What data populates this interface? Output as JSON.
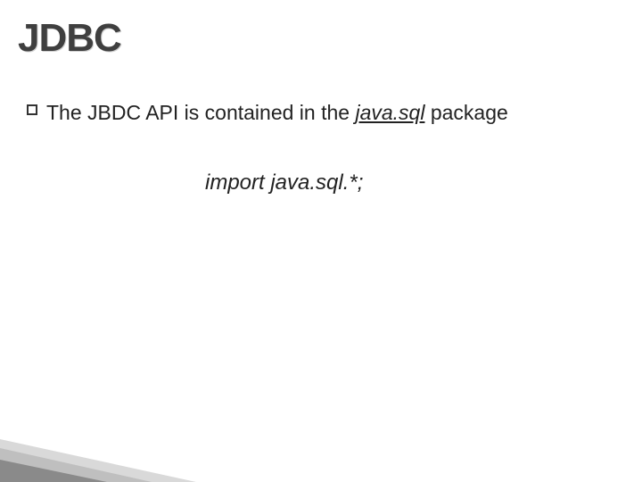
{
  "slide": {
    "title": "JDBC",
    "bullet": {
      "pre": "The JBDC API is contained in the ",
      "pkg": "java.sql",
      "post": " package"
    },
    "import_line": "import java.sql.*;"
  }
}
